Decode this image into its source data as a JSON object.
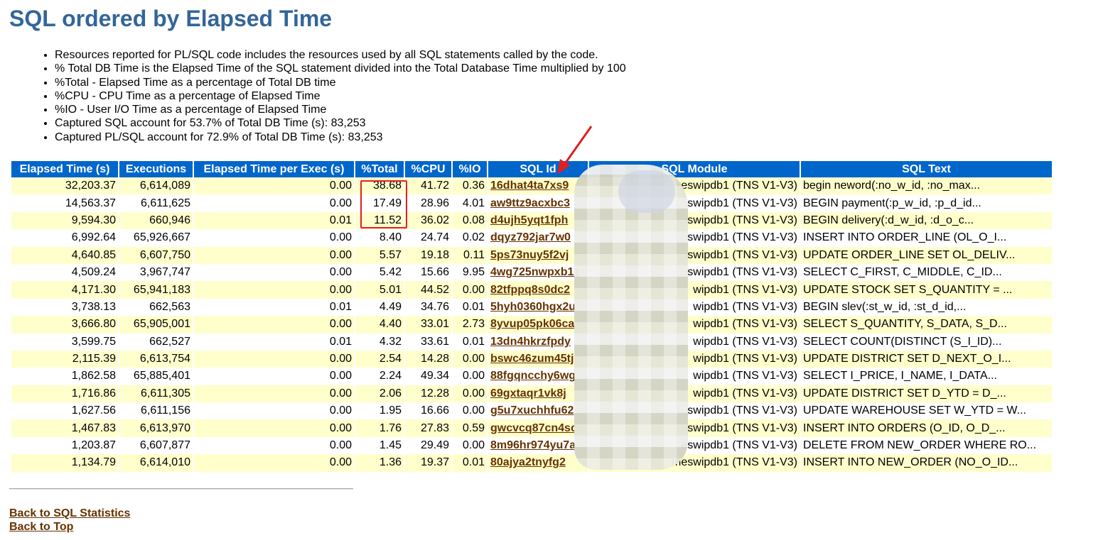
{
  "title": "SQL ordered by Elapsed Time",
  "notes": [
    "Resources reported for PL/SQL code includes the resources used by all SQL statements called by the code.",
    "% Total DB Time is the Elapsed Time of the SQL statement divided into the Total Database Time multiplied by 100",
    "%Total - Elapsed Time as a percentage of Total DB time",
    "%CPU - CPU Time as a percentage of Elapsed Time",
    "%IO - User I/O Time as a percentage of Elapsed Time",
    "Captured SQL account for 53.7% of Total DB Time (s): 83,253",
    "Captured PL/SQL account for 72.9% of Total DB Time (s): 83,253"
  ],
  "columns": [
    "Elapsed Time (s)",
    "Executions",
    "Elapsed Time per Exec (s)",
    "%Total",
    "%CPU",
    "%IO",
    "SQL Id",
    "SQL Module",
    "SQL Text"
  ],
  "rows": [
    {
      "elapsed": "32,203.37",
      "execs": "6,614,089",
      "per_exec": "0.00",
      "total": "38.68",
      "cpu": "41.72",
      "io": "0.36",
      "sql_id": "16dhat4ta7xs9",
      "module": "eswipdb1 (TNS V1-V3)",
      "text": "begin neword(:no_w_id, :no_max..."
    },
    {
      "elapsed": "14,563.37",
      "execs": "6,611,625",
      "per_exec": "0.00",
      "total": "17.49",
      "cpu": "28.96",
      "io": "4.01",
      "sql_id": "aw9ttz9acxbc3",
      "module": "swipdb1 (TNS V1-V3)",
      "text": "BEGIN payment(:p_w_id, :p_d_id..."
    },
    {
      "elapsed": "9,594.30",
      "execs": "660,946",
      "per_exec": "0.01",
      "total": "11.52",
      "cpu": "36.02",
      "io": "0.08",
      "sql_id": "d4ujh5yqt1fph",
      "module": "swipdb1 (TNS V1-V3)",
      "text": "BEGIN delivery(:d_w_id, :d_o_c..."
    },
    {
      "elapsed": "6,992.64",
      "execs": "65,926,667",
      "per_exec": "0.00",
      "total": "8.40",
      "cpu": "24.74",
      "io": "0.02",
      "sql_id": "dqyz792jar7w0",
      "module": "swipdb1 (TNS V1-V3)",
      "text": "INSERT INTO ORDER_LINE (OL_O_I..."
    },
    {
      "elapsed": "4,640.85",
      "execs": "6,607,750",
      "per_exec": "0.00",
      "total": "5.57",
      "cpu": "19.18",
      "io": "0.11",
      "sql_id": "5ps73nuy5f2vj",
      "module": "swipdb1 (TNS V1-V3)",
      "text": "UPDATE ORDER_LINE SET OL_DELIV..."
    },
    {
      "elapsed": "4,509.24",
      "execs": "3,967,747",
      "per_exec": "0.00",
      "total": "5.42",
      "cpu": "15.66",
      "io": "9.95",
      "sql_id": "4wg725nwpxb1z",
      "module": "swipdb1 (TNS V1-V3)",
      "text": "SELECT C_FIRST, C_MIDDLE, C_ID..."
    },
    {
      "elapsed": "4,171.30",
      "execs": "65,941,183",
      "per_exec": "0.00",
      "total": "5.01",
      "cpu": "44.52",
      "io": "0.00",
      "sql_id": "82tfppq8s0dc2",
      "module": "wipdb1 (TNS V1-V3)",
      "text": "UPDATE STOCK SET S_QUANTITY = ..."
    },
    {
      "elapsed": "3,738.13",
      "execs": "662,563",
      "per_exec": "0.01",
      "total": "4.49",
      "cpu": "34.76",
      "io": "0.01",
      "sql_id": "5hyh0360hgx2u",
      "module": "wipdb1 (TNS V1-V3)",
      "text": "BEGIN slev(:st_w_id, :st_d_id,..."
    },
    {
      "elapsed": "3,666.80",
      "execs": "65,905,001",
      "per_exec": "0.00",
      "total": "4.40",
      "cpu": "33.01",
      "io": "2.73",
      "sql_id": "8yvup05pk06ca",
      "module": "wipdb1 (TNS V1-V3)",
      "text": "SELECT S_QUANTITY, S_DATA, S_D..."
    },
    {
      "elapsed": "3,599.75",
      "execs": "662,527",
      "per_exec": "0.01",
      "total": "4.32",
      "cpu": "33.61",
      "io": "0.01",
      "sql_id": "13dn4hkrzfpdy",
      "module": "wipdb1 (TNS V1-V3)",
      "text": "SELECT COUNT(DISTINCT (S_I_ID)..."
    },
    {
      "elapsed": "2,115.39",
      "execs": "6,613,754",
      "per_exec": "0.00",
      "total": "2.54",
      "cpu": "14.28",
      "io": "0.00",
      "sql_id": "bswc46zum45tj",
      "module": "wipdb1 (TNS V1-V3)",
      "text": "UPDATE DISTRICT SET D_NEXT_O_I..."
    },
    {
      "elapsed": "1,862.58",
      "execs": "65,885,401",
      "per_exec": "0.00",
      "total": "2.24",
      "cpu": "49.34",
      "io": "0.00",
      "sql_id": "88fgqncchy6wg",
      "module": "wipdb1 (TNS V1-V3)",
      "text": "SELECT I_PRICE, I_NAME, I_DATA..."
    },
    {
      "elapsed": "1,716.86",
      "execs": "6,611,305",
      "per_exec": "0.00",
      "total": "2.06",
      "cpu": "12.28",
      "io": "0.00",
      "sql_id": "69gxtaqr1vk8j",
      "module": "wipdb1 (TNS V1-V3)",
      "text": "UPDATE DISTRICT SET D_YTD = D_..."
    },
    {
      "elapsed": "1,627.56",
      "execs": "6,611,156",
      "per_exec": "0.00",
      "total": "1.95",
      "cpu": "16.66",
      "io": "0.00",
      "sql_id": "g5u7xuchhfu62",
      "module": "swipdb1 (TNS V1-V3)",
      "text": "UPDATE WAREHOUSE SET W_YTD = W..."
    },
    {
      "elapsed": "1,467.83",
      "execs": "6,613,970",
      "per_exec": "0.00",
      "total": "1.76",
      "cpu": "27.83",
      "io": "0.59",
      "sql_id": "gwcvcq87cn4sc",
      "module": "swipdb1 (TNS V1-V3)",
      "text": "INSERT INTO ORDERS (O_ID, O_D_..."
    },
    {
      "elapsed": "1,203.87",
      "execs": "6,607,877",
      "per_exec": "0.00",
      "total": "1.45",
      "cpu": "29.49",
      "io": "0.00",
      "sql_id": "8m96hr974yu7a",
      "module": "eswipdb1 (TNS V1-V3)",
      "text": "DELETE FROM NEW_ORDER WHERE RO..."
    },
    {
      "elapsed": "1,134.79",
      "execs": "6,614,010",
      "per_exec": "0.00",
      "total": "1.36",
      "cpu": "19.37",
      "io": "0.01",
      "sql_id": "80ajya2tnyfg2",
      "module": "meswipdb1 (TNS V1-V3)",
      "text": "INSERT INTO NEW_ORDER (NO_O_ID..."
    }
  ],
  "footer": {
    "back_to_sql_statistics": "Back to SQL Statistics",
    "back_to_top": "Back to Top"
  },
  "colors": {
    "title": "#336699",
    "header_bg": "#0066cc",
    "row_alt_bg": "#ffffcc",
    "link": "#663300",
    "annotation": "#e02020"
  }
}
